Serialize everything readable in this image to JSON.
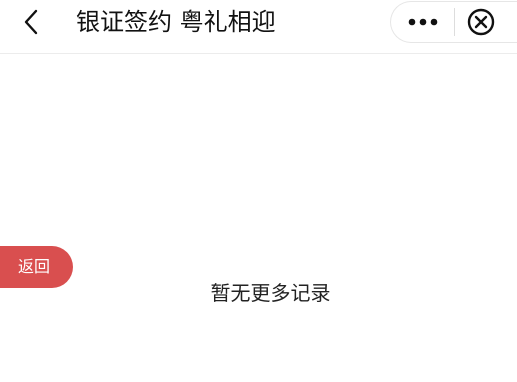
{
  "navbar": {
    "title": "银证签约 粤礼相迎",
    "back_icon": "chevron-left-icon",
    "more_icon": "more-dots-icon",
    "close_icon": "close-circle-icon"
  },
  "float_button": {
    "label": "返回",
    "color": "#d94f4f"
  },
  "content": {
    "empty_message": "暂无更多记录"
  }
}
